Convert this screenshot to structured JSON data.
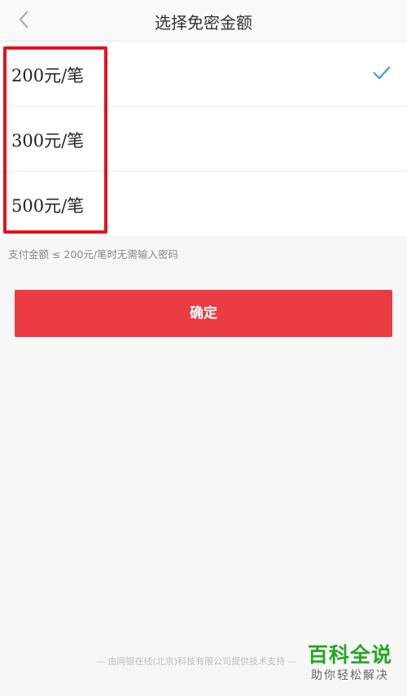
{
  "header": {
    "title": "选择免密金额",
    "back_icon": "chevron-left-icon"
  },
  "options": [
    {
      "label": "200元/笔",
      "selected": true
    },
    {
      "label": "300元/笔",
      "selected": false
    },
    {
      "label": "500元/笔",
      "selected": false
    }
  ],
  "check_icon": "checkmark-icon",
  "hint": "支付金额 ≤ 200元/笔时无需输入密码",
  "confirm_label": "确定",
  "footer": {
    "provider": "— 由网银在线(北京)科技有限公司提供技术支持 —"
  },
  "watermark": {
    "title": "百科全说",
    "subtitle": "助你轻松解决"
  },
  "colors": {
    "accent": "#ea3c42",
    "check": "#3a9ee8",
    "highlight": "#e3131b",
    "watermark": "#22a81e"
  }
}
